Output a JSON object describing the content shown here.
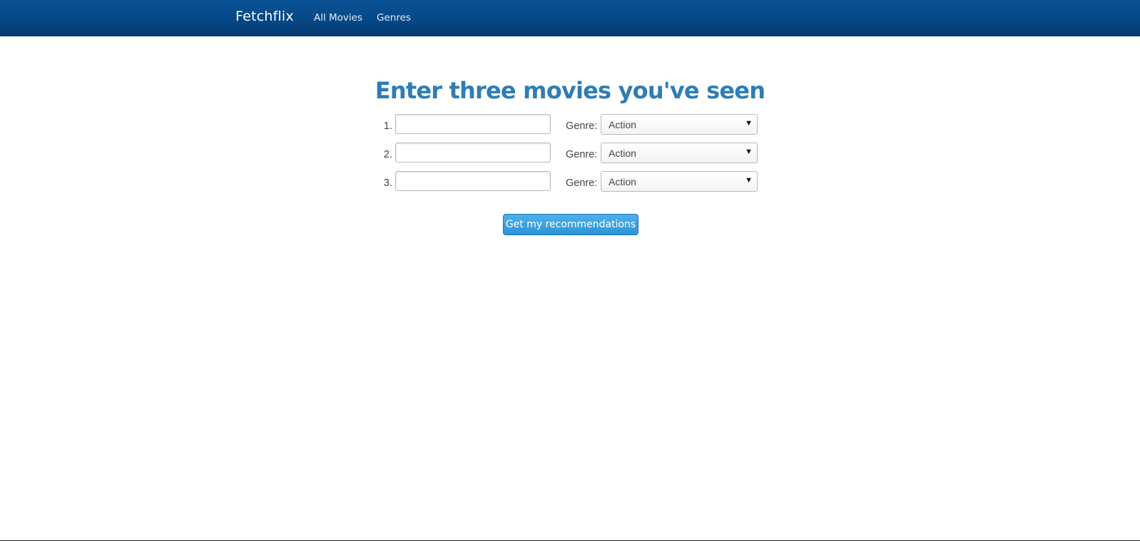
{
  "navbar": {
    "brand": "Fetchflix",
    "links": [
      {
        "label": "All Movies"
      },
      {
        "label": "Genres"
      }
    ]
  },
  "form": {
    "title": "Enter three movies you've seen",
    "rows": [
      {
        "number": "1.",
        "movie_value": "",
        "genre_label": "Genre:",
        "genre_selected": "Action"
      },
      {
        "number": "2.",
        "movie_value": "",
        "genre_label": "Genre:",
        "genre_selected": "Action"
      },
      {
        "number": "3.",
        "movie_value": "",
        "genre_label": "Genre:",
        "genre_selected": "Action"
      }
    ],
    "submit_label": "Get my recommendations"
  },
  "icons": {
    "dropdown": "chevron-down-icon"
  },
  "colors": {
    "navbar": "#064886",
    "title": "#2f7db4",
    "button": "#3aa1e0"
  }
}
